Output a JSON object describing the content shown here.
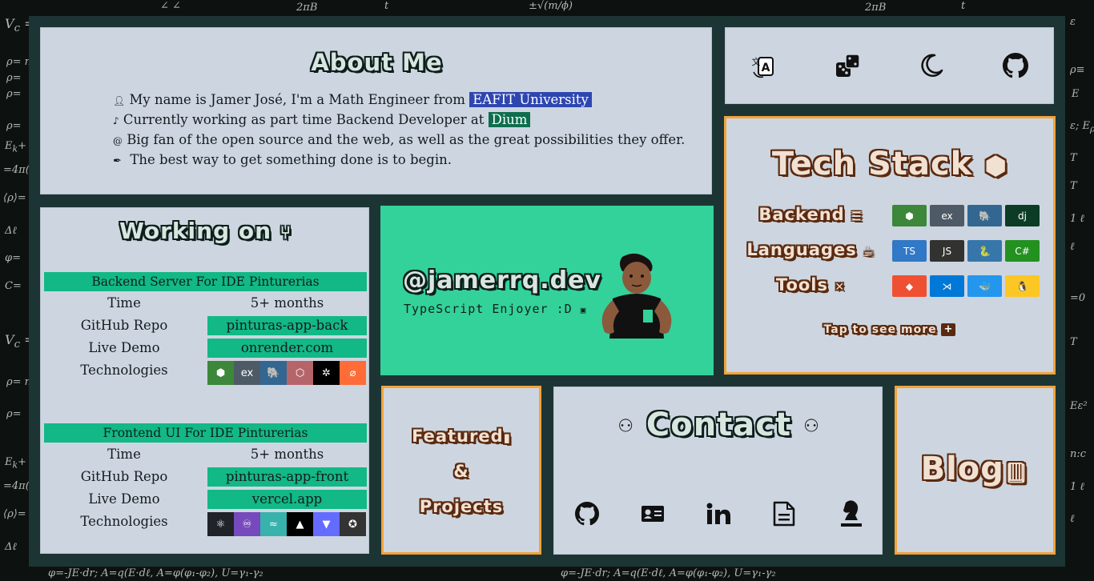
{
  "about": {
    "title": "About Me",
    "lines": [
      {
        "icon": "user-icon",
        "text": "My name is Jamer José, I'm a Math Engineer from ",
        "highlight": "EAFIT University"
      },
      {
        "icon": "coffee-icon",
        "text": "Currently working as part time Backend Developer at ",
        "highlight": "Dium"
      },
      {
        "icon": "at-icon",
        "text": "Big fan of the open source and the web, as well as the great possibilities they offer."
      },
      {
        "icon": "feather-icon",
        "text": "The best way to get something done is to begin."
      }
    ]
  },
  "toolbar": {
    "icons": [
      "translate-icon",
      "dice-icon",
      "moon-icon",
      "github-icon"
    ]
  },
  "tech_stack": {
    "title": "Tech Stack",
    "rows": [
      {
        "label": "Backend",
        "icon": "server-icon",
        "badges": [
          {
            "name": "nodejs-badge",
            "text": "⬢",
            "color": "#3c873a"
          },
          {
            "name": "express-badge",
            "text": "ex",
            "color": "#4e5b66"
          },
          {
            "name": "postgresql-badge",
            "text": "🐘",
            "color": "#336791"
          },
          {
            "name": "django-badge",
            "text": "dj",
            "color": "#0c3c26"
          }
        ]
      },
      {
        "label": "Languages",
        "icon": "java-icon",
        "badges": [
          {
            "name": "typescript-badge",
            "text": "TS",
            "color": "#3178c6"
          },
          {
            "name": "javascript-badge",
            "text": "JS",
            "color": "#323330"
          },
          {
            "name": "python-badge",
            "text": "🐍",
            "color": "#3776ab"
          },
          {
            "name": "csharp-badge",
            "text": "C#",
            "color": "#239120"
          }
        ]
      },
      {
        "label": "Tools",
        "icon": "tools-icon",
        "badges": [
          {
            "name": "git-badge",
            "text": "◆",
            "color": "#f05032"
          },
          {
            "name": "vscode-badge",
            "text": "⋊",
            "color": "#0078d7"
          },
          {
            "name": "docker-badge",
            "text": "🐳",
            "color": "#2496ed"
          },
          {
            "name": "linux-badge",
            "text": "🐧",
            "color": "#fcc624"
          }
        ]
      }
    ],
    "more": "Tap to see more"
  },
  "working": {
    "title": "Working on",
    "projects": [
      {
        "heading": "Backend Server For IDE Pinturerias",
        "time_label": "Time",
        "time": "5+ months",
        "repo_label": "GitHub Repo",
        "repo": "pinturas-app-back",
        "demo_label": "Live Demo",
        "demo": "onrender.com",
        "tech_label": "Technologies",
        "tech": [
          {
            "name": "nodejs-chip",
            "text": "⬢",
            "color": "#3c873a"
          },
          {
            "name": "express-chip",
            "text": "ex",
            "color": "#4e5b66"
          },
          {
            "name": "postgresql-chip",
            "text": "🐘",
            "color": "#336791"
          },
          {
            "name": "nestjs-chip",
            "text": "⬡",
            "color": "#b5656a"
          },
          {
            "name": "sequelize-chip",
            "text": "✲",
            "color": "#000000"
          },
          {
            "name": "swagger-chip",
            "text": "⌀",
            "color": "#ff6c37"
          }
        ]
      },
      {
        "heading": "Frontend UI For IDE Pinturerias",
        "time_label": "Time",
        "time": "5+ months",
        "repo_label": "GitHub Repo",
        "repo": "pinturas-app-front",
        "demo_label": "Live Demo",
        "demo": "vercel.app",
        "tech_label": "Technologies",
        "tech": [
          {
            "name": "react-chip",
            "text": "⚛",
            "color": "#20232a"
          },
          {
            "name": "redux-chip",
            "text": "♾",
            "color": "#764abc"
          },
          {
            "name": "tailwind-chip",
            "text": "≈",
            "color": "#38b2ac"
          },
          {
            "name": "nextjs-chip",
            "text": "▲",
            "color": "#000000"
          },
          {
            "name": "vite-chip",
            "text": "▼",
            "color": "#646cff"
          },
          {
            "name": "jest-chip",
            "text": "✪",
            "color": "#333333"
          }
        ]
      }
    ]
  },
  "profile": {
    "handle": "@jamerrq.dev",
    "tagline": "TypeScript Enjoyer :D",
    "bg": "#33d29a"
  },
  "featured": {
    "line1": "Featured",
    "amp": "&",
    "line2": "Projects"
  },
  "contact": {
    "title": "Contact",
    "icons": [
      "github-icon",
      "contact-card-icon",
      "linkedin-icon",
      "resume-icon",
      "chess-icon"
    ]
  },
  "blog": {
    "title": "Blog"
  },
  "colors": {
    "board": "#1c3534",
    "card": "#cdd6e0",
    "accent_orange": "#f2a33a",
    "accent_green": "#12b886"
  }
}
